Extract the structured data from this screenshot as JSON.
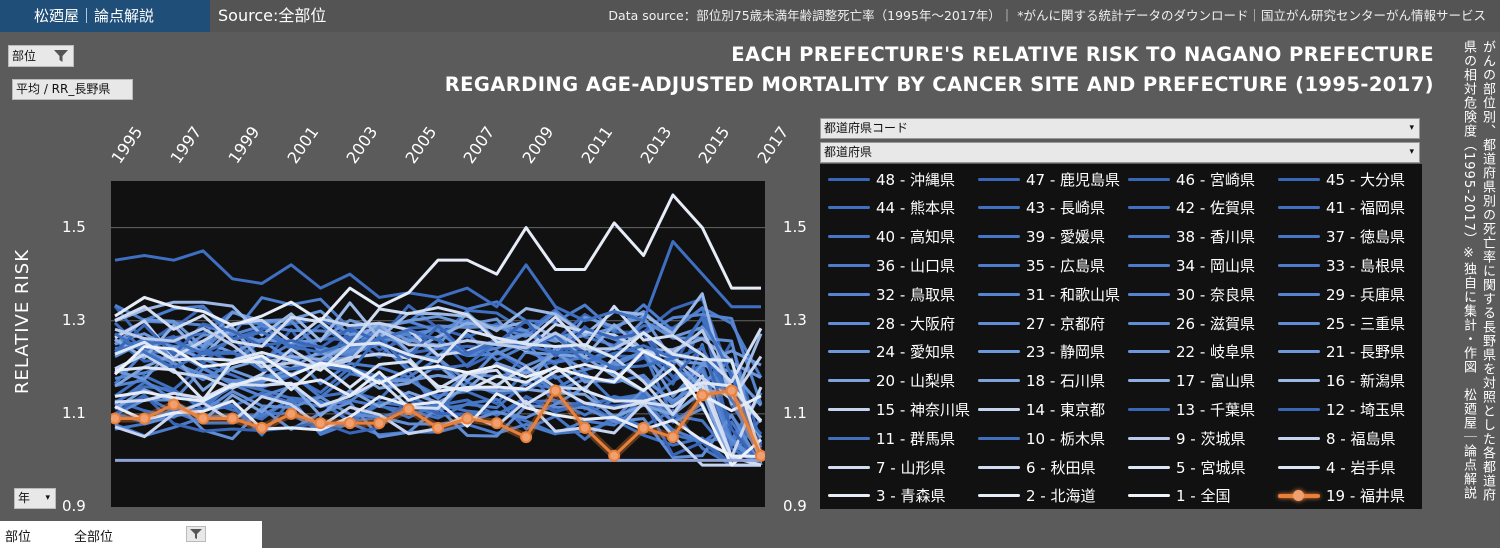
{
  "header": {
    "brand": "松廼屋｜論点解説",
    "source": "Source:全部位",
    "data_source": "Data source：部位別75歳未満年齢調整死亡率（1995年～2017年）｜ *がんに関する統計データのダウンロード｜国立がん研究センターがん情報サービス"
  },
  "controls": {
    "site_filter": "部位",
    "measure": "平均 / RR_長野県",
    "year_filter": "年",
    "pref_code_slicer": "都道府県コード",
    "pref_slicer": "都道府県"
  },
  "title": {
    "line1": "EACH PREFECTURE'S RELATIVE RISK TO NAGANO PREFECTURE",
    "line2": "REGARDING AGE-ADJUSTED MORTALITY BY CANCER SITE AND PREFECTURE (1995-2017)"
  },
  "side_note": "がんの部位別、都道府県別の死亡率に関する長野県を対照とした各都道府県の相対危険度（1995-2017）※独自に集計・作図　松廼屋｜論点解説",
  "bottom_filter": {
    "key": "部位",
    "value": "全部位"
  },
  "colors": {
    "fukui": "#e8803a",
    "blue_dark": "#2e5fb0",
    "blue_light": "#dde6f5",
    "plot_bg": "#111111"
  },
  "legend": [
    {
      "label": "48 - 沖縄県",
      "color": "#3a66b8"
    },
    {
      "label": "47 - 鹿児島県",
      "color": "#3a66b8"
    },
    {
      "label": "46 - 宮崎県",
      "color": "#3a66b8"
    },
    {
      "label": "45 - 大分県",
      "color": "#3a66b8"
    },
    {
      "label": "44 - 熊本県",
      "color": "#4070c0"
    },
    {
      "label": "43 - 長崎県",
      "color": "#4070c0"
    },
    {
      "label": "42 - 佐賀県",
      "color": "#4070c0"
    },
    {
      "label": "41 - 福岡県",
      "color": "#4070c0"
    },
    {
      "label": "40 - 高知県",
      "color": "#4676c6"
    },
    {
      "label": "39 - 愛媛県",
      "color": "#4676c6"
    },
    {
      "label": "38 - 香川県",
      "color": "#4676c6"
    },
    {
      "label": "37 - 徳島県",
      "color": "#4676c6"
    },
    {
      "label": "36 - 山口県",
      "color": "#4c7dcc"
    },
    {
      "label": "35 - 広島県",
      "color": "#4c7dcc"
    },
    {
      "label": "34 - 岡山県",
      "color": "#4c7dcc"
    },
    {
      "label": "33 - 島根県",
      "color": "#4c7dcc"
    },
    {
      "label": "32 - 鳥取県",
      "color": "#5585d2"
    },
    {
      "label": "31 - 和歌山県",
      "color": "#5585d2"
    },
    {
      "label": "30 - 奈良県",
      "color": "#5585d2"
    },
    {
      "label": "29 - 兵庫県",
      "color": "#5585d2"
    },
    {
      "label": "28 - 大阪府",
      "color": "#608dd6"
    },
    {
      "label": "27 - 京都府",
      "color": "#608dd6"
    },
    {
      "label": "26 - 滋賀県",
      "color": "#608dd6"
    },
    {
      "label": "25 - 三重県",
      "color": "#608dd6"
    },
    {
      "label": "24 - 愛知県",
      "color": "#6c97da"
    },
    {
      "label": "23 - 静岡県",
      "color": "#6c97da"
    },
    {
      "label": "22 - 岐阜県",
      "color": "#6c97da"
    },
    {
      "label": "21 - 長野県",
      "color": "#6c97da"
    },
    {
      "label": "20 - 山梨県",
      "color": "#7da3de"
    },
    {
      "label": "18 - 石川県",
      "color": "#7da3de"
    },
    {
      "label": "17 - 富山県",
      "color": "#8daee2"
    },
    {
      "label": "16 - 新潟県",
      "color": "#9bb8e6"
    },
    {
      "label": "15 - 神奈川県",
      "color": "#c6d4ef"
    },
    {
      "label": "14 - 東京都",
      "color": "#c6d4ef"
    },
    {
      "label": "13 - 千葉県",
      "color": "#3a66b8"
    },
    {
      "label": "12 - 埼玉県",
      "color": "#3a66b8"
    },
    {
      "label": "11 - 群馬県",
      "color": "#4070c0"
    },
    {
      "label": "10 - 栃木県",
      "color": "#4070c0"
    },
    {
      "label": "9 - 茨城県",
      "color": "#b9caeb"
    },
    {
      "label": "8 - 福島県",
      "color": "#c6d4ef"
    },
    {
      "label": "7 - 山形県",
      "color": "#d2ddf2"
    },
    {
      "label": "6 - 秋田県",
      "color": "#d2ddf2"
    },
    {
      "label": "5 - 宮城県",
      "color": "#dde6f5"
    },
    {
      "label": "4 - 岩手県",
      "color": "#dde6f5"
    },
    {
      "label": "3 - 青森県",
      "color": "#e6ecf8"
    },
    {
      "label": "2 - 北海道",
      "color": "#e6ecf8"
    },
    {
      "label": "1 - 全国",
      "color": "#eef2fa"
    },
    {
      "label": "19 - 福井県",
      "color": "#e8803a"
    }
  ],
  "chart_data": {
    "type": "line",
    "x": [
      1995,
      1996,
      1997,
      1998,
      1999,
      2000,
      2001,
      2002,
      2003,
      2004,
      2005,
      2006,
      2007,
      2008,
      2009,
      2010,
      2011,
      2012,
      2013,
      2014,
      2015,
      2016,
      2017
    ],
    "x_tick_labels": [
      "1995",
      "1997",
      "1999",
      "2001",
      "2003",
      "2005",
      "2007",
      "2009",
      "2011",
      "2013",
      "2015",
      "2017"
    ],
    "ylabel": "RELATIVE RISK",
    "ylim": [
      0.9,
      1.6
    ],
    "y_ticks": [
      0.9,
      1.1,
      1.3,
      1.5
    ],
    "y_tick_labels": [
      "0.9",
      "1.1",
      "1.3",
      "1.5"
    ],
    "series_highlight": {
      "name": "19 - 福井県",
      "values": [
        1.09,
        1.09,
        1.12,
        1.09,
        1.09,
        1.07,
        1.1,
        1.08,
        1.08,
        1.08,
        1.11,
        1.07,
        1.09,
        1.08,
        1.05,
        1.15,
        1.07,
        1.01,
        1.07,
        1.05,
        1.14,
        1.15,
        1.01
      ]
    },
    "series_reference": {
      "name": "21 - 長野県",
      "values": [
        1.0,
        1.0,
        1.0,
        1.0,
        1.0,
        1.0,
        1.0,
        1.0,
        1.0,
        1.0,
        1.0,
        1.0,
        1.0,
        1.0,
        1.0,
        1.0,
        1.0,
        1.0,
        1.0,
        1.0,
        1.0,
        1.0,
        1.0
      ]
    },
    "series_top": {
      "values": [
        1.31,
        1.35,
        1.33,
        1.32,
        1.29,
        1.31,
        1.34,
        1.3,
        1.37,
        1.33,
        1.36,
        1.43,
        1.43,
        1.4,
        1.5,
        1.41,
        1.41,
        1.51,
        1.44,
        1.57,
        1.5,
        1.37,
        1.37
      ]
    },
    "series_high": {
      "values": [
        1.43,
        1.44,
        1.43,
        1.45,
        1.39,
        1.38,
        1.42,
        1.37,
        1.4,
        1.35,
        1.36,
        1.35,
        1.37,
        1.33,
        1.42,
        1.33,
        1.3,
        1.32,
        1.3,
        1.47,
        1.4,
        1.33,
        1.33
      ]
    }
  }
}
